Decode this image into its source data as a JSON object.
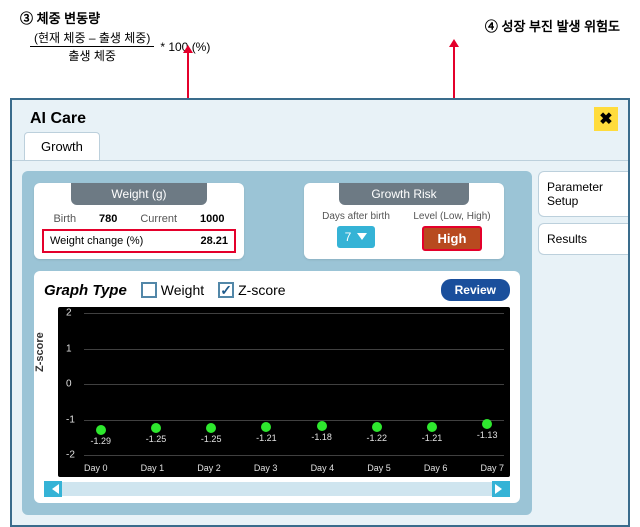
{
  "annotations": {
    "ann3_title": "③ 체중 변동량",
    "ann3_frac_top": "(현재 체중 – 출생 체중)",
    "ann3_frac_bot": "출생 체중",
    "ann3_suffix": "* 100 (%)",
    "ann4_title": "④ 성장 부진 발생 위험도"
  },
  "panel": {
    "title": "AI Care",
    "close": "✖",
    "tab_growth": "Growth",
    "side_param": "Parameter Setup",
    "side_results": "Results"
  },
  "weight_card": {
    "header": "Weight (g)",
    "birth_label": "Birth",
    "birth_value": "780",
    "current_label": "Current",
    "current_value": "1000",
    "change_label": "Weight change (%)",
    "change_value": "28.21"
  },
  "risk_card": {
    "header": "Growth Risk",
    "days_label": "Days after birth",
    "days_value": "7",
    "level_label": "Level (Low, High)",
    "level_value": "High"
  },
  "graph": {
    "type_label": "Graph Type",
    "opt_weight": "Weight",
    "opt_zscore": "Z-score",
    "review": "Review",
    "yaxis": "Z-score"
  },
  "chart_data": {
    "type": "scatter",
    "title": "",
    "xlabel": "",
    "ylabel": "Z-score",
    "ylim": [
      -2,
      2
    ],
    "yticks": [
      -2,
      -1,
      0,
      1,
      2
    ],
    "categories": [
      "Day 0",
      "Day 1",
      "Day 2",
      "Day 3",
      "Day 4",
      "Day 5",
      "Day 6",
      "Day 7"
    ],
    "series": [
      {
        "name": "Z-score",
        "values": [
          -1.29,
          -1.25,
          -1.25,
          -1.21,
          -1.18,
          -1.22,
          -1.21,
          -1.13
        ]
      }
    ]
  }
}
